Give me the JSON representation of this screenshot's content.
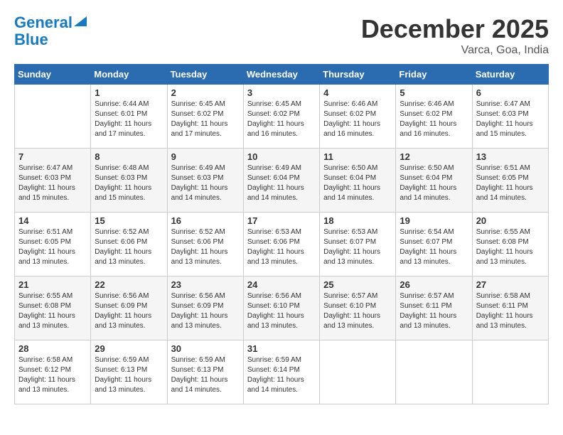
{
  "logo": {
    "line1": "General",
    "line2": "Blue"
  },
  "title": "December 2025",
  "location": "Varca, Goa, India",
  "days_header": [
    "Sunday",
    "Monday",
    "Tuesday",
    "Wednesday",
    "Thursday",
    "Friday",
    "Saturday"
  ],
  "weeks": [
    [
      {
        "day": "",
        "sunrise": "",
        "sunset": "",
        "daylight": ""
      },
      {
        "day": "1",
        "sunrise": "Sunrise: 6:44 AM",
        "sunset": "Sunset: 6:01 PM",
        "daylight": "Daylight: 11 hours and 17 minutes."
      },
      {
        "day": "2",
        "sunrise": "Sunrise: 6:45 AM",
        "sunset": "Sunset: 6:02 PM",
        "daylight": "Daylight: 11 hours and 17 minutes."
      },
      {
        "day": "3",
        "sunrise": "Sunrise: 6:45 AM",
        "sunset": "Sunset: 6:02 PM",
        "daylight": "Daylight: 11 hours and 16 minutes."
      },
      {
        "day": "4",
        "sunrise": "Sunrise: 6:46 AM",
        "sunset": "Sunset: 6:02 PM",
        "daylight": "Daylight: 11 hours and 16 minutes."
      },
      {
        "day": "5",
        "sunrise": "Sunrise: 6:46 AM",
        "sunset": "Sunset: 6:02 PM",
        "daylight": "Daylight: 11 hours and 16 minutes."
      },
      {
        "day": "6",
        "sunrise": "Sunrise: 6:47 AM",
        "sunset": "Sunset: 6:03 PM",
        "daylight": "Daylight: 11 hours and 15 minutes."
      }
    ],
    [
      {
        "day": "7",
        "sunrise": "Sunrise: 6:47 AM",
        "sunset": "Sunset: 6:03 PM",
        "daylight": "Daylight: 11 hours and 15 minutes."
      },
      {
        "day": "8",
        "sunrise": "Sunrise: 6:48 AM",
        "sunset": "Sunset: 6:03 PM",
        "daylight": "Daylight: 11 hours and 15 minutes."
      },
      {
        "day": "9",
        "sunrise": "Sunrise: 6:49 AM",
        "sunset": "Sunset: 6:03 PM",
        "daylight": "Daylight: 11 hours and 14 minutes."
      },
      {
        "day": "10",
        "sunrise": "Sunrise: 6:49 AM",
        "sunset": "Sunset: 6:04 PM",
        "daylight": "Daylight: 11 hours and 14 minutes."
      },
      {
        "day": "11",
        "sunrise": "Sunrise: 6:50 AM",
        "sunset": "Sunset: 6:04 PM",
        "daylight": "Daylight: 11 hours and 14 minutes."
      },
      {
        "day": "12",
        "sunrise": "Sunrise: 6:50 AM",
        "sunset": "Sunset: 6:04 PM",
        "daylight": "Daylight: 11 hours and 14 minutes."
      },
      {
        "day": "13",
        "sunrise": "Sunrise: 6:51 AM",
        "sunset": "Sunset: 6:05 PM",
        "daylight": "Daylight: 11 hours and 14 minutes."
      }
    ],
    [
      {
        "day": "14",
        "sunrise": "Sunrise: 6:51 AM",
        "sunset": "Sunset: 6:05 PM",
        "daylight": "Daylight: 11 hours and 13 minutes."
      },
      {
        "day": "15",
        "sunrise": "Sunrise: 6:52 AM",
        "sunset": "Sunset: 6:06 PM",
        "daylight": "Daylight: 11 hours and 13 minutes."
      },
      {
        "day": "16",
        "sunrise": "Sunrise: 6:52 AM",
        "sunset": "Sunset: 6:06 PM",
        "daylight": "Daylight: 11 hours and 13 minutes."
      },
      {
        "day": "17",
        "sunrise": "Sunrise: 6:53 AM",
        "sunset": "Sunset: 6:06 PM",
        "daylight": "Daylight: 11 hours and 13 minutes."
      },
      {
        "day": "18",
        "sunrise": "Sunrise: 6:53 AM",
        "sunset": "Sunset: 6:07 PM",
        "daylight": "Daylight: 11 hours and 13 minutes."
      },
      {
        "day": "19",
        "sunrise": "Sunrise: 6:54 AM",
        "sunset": "Sunset: 6:07 PM",
        "daylight": "Daylight: 11 hours and 13 minutes."
      },
      {
        "day": "20",
        "sunrise": "Sunrise: 6:55 AM",
        "sunset": "Sunset: 6:08 PM",
        "daylight": "Daylight: 11 hours and 13 minutes."
      }
    ],
    [
      {
        "day": "21",
        "sunrise": "Sunrise: 6:55 AM",
        "sunset": "Sunset: 6:08 PM",
        "daylight": "Daylight: 11 hours and 13 minutes."
      },
      {
        "day": "22",
        "sunrise": "Sunrise: 6:56 AM",
        "sunset": "Sunset: 6:09 PM",
        "daylight": "Daylight: 11 hours and 13 minutes."
      },
      {
        "day": "23",
        "sunrise": "Sunrise: 6:56 AM",
        "sunset": "Sunset: 6:09 PM",
        "daylight": "Daylight: 11 hours and 13 minutes."
      },
      {
        "day": "24",
        "sunrise": "Sunrise: 6:56 AM",
        "sunset": "Sunset: 6:10 PM",
        "daylight": "Daylight: 11 hours and 13 minutes."
      },
      {
        "day": "25",
        "sunrise": "Sunrise: 6:57 AM",
        "sunset": "Sunset: 6:10 PM",
        "daylight": "Daylight: 11 hours and 13 minutes."
      },
      {
        "day": "26",
        "sunrise": "Sunrise: 6:57 AM",
        "sunset": "Sunset: 6:11 PM",
        "daylight": "Daylight: 11 hours and 13 minutes."
      },
      {
        "day": "27",
        "sunrise": "Sunrise: 6:58 AM",
        "sunset": "Sunset: 6:11 PM",
        "daylight": "Daylight: 11 hours and 13 minutes."
      }
    ],
    [
      {
        "day": "28",
        "sunrise": "Sunrise: 6:58 AM",
        "sunset": "Sunset: 6:12 PM",
        "daylight": "Daylight: 11 hours and 13 minutes."
      },
      {
        "day": "29",
        "sunrise": "Sunrise: 6:59 AM",
        "sunset": "Sunset: 6:13 PM",
        "daylight": "Daylight: 11 hours and 13 minutes."
      },
      {
        "day": "30",
        "sunrise": "Sunrise: 6:59 AM",
        "sunset": "Sunset: 6:13 PM",
        "daylight": "Daylight: 11 hours and 14 minutes."
      },
      {
        "day": "31",
        "sunrise": "Sunrise: 6:59 AM",
        "sunset": "Sunset: 6:14 PM",
        "daylight": "Daylight: 11 hours and 14 minutes."
      },
      {
        "day": "",
        "sunrise": "",
        "sunset": "",
        "daylight": ""
      },
      {
        "day": "",
        "sunrise": "",
        "sunset": "",
        "daylight": ""
      },
      {
        "day": "",
        "sunrise": "",
        "sunset": "",
        "daylight": ""
      }
    ]
  ]
}
